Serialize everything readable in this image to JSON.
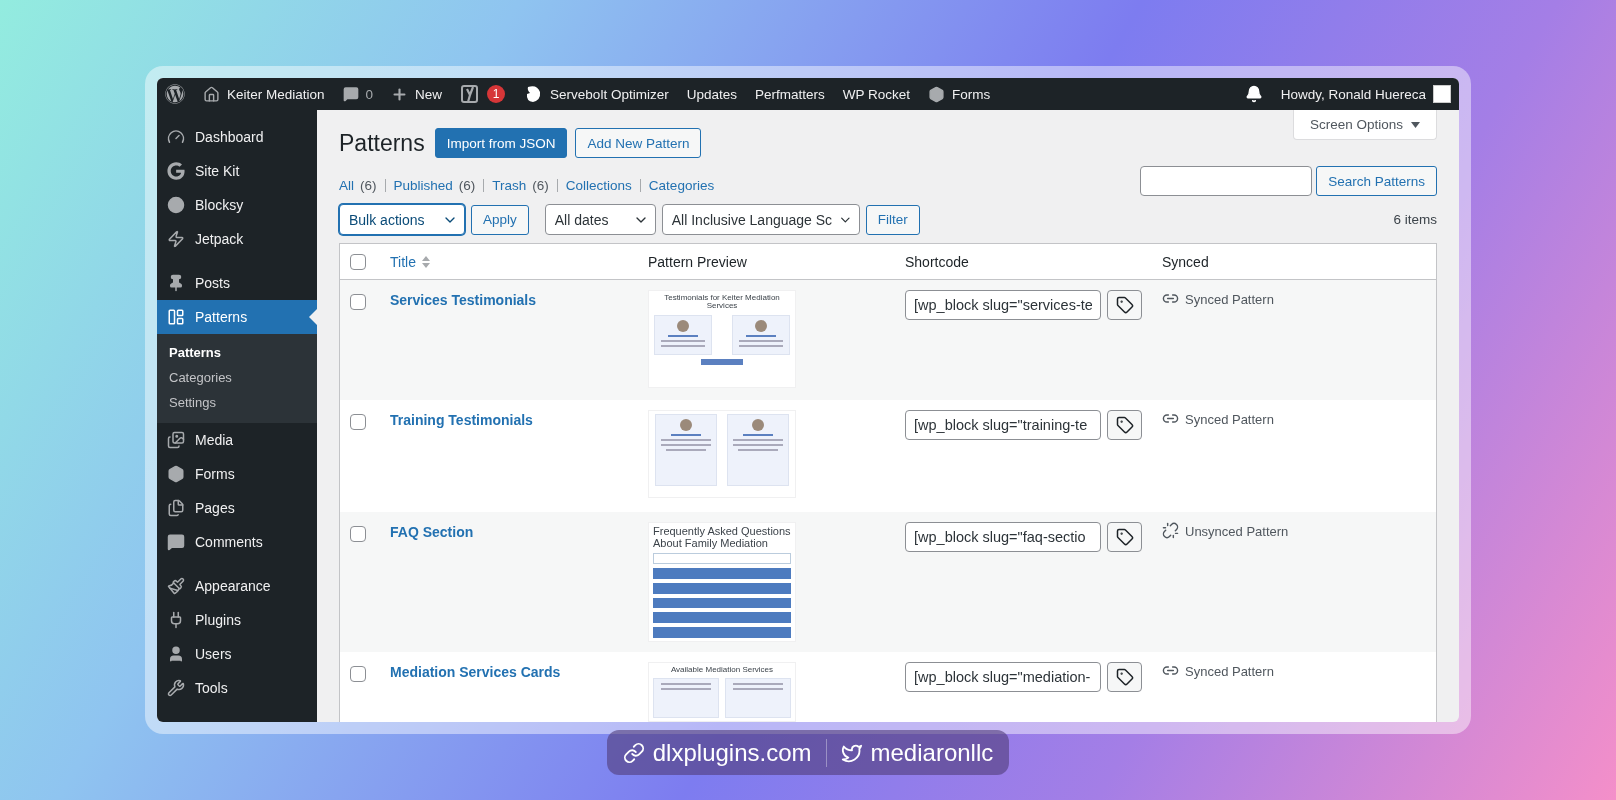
{
  "admin_bar": {
    "items": [
      {
        "kind": "wp-logo"
      },
      {
        "kind": "site",
        "label": "Keiter Mediation"
      },
      {
        "kind": "comments",
        "label": "0"
      },
      {
        "kind": "new",
        "label": "New"
      },
      {
        "kind": "yoast",
        "badge": "1"
      },
      {
        "kind": "servebolt",
        "label": "Servebolt Optimizer"
      },
      {
        "kind": "text",
        "label": "Updates"
      },
      {
        "kind": "text",
        "label": "Perfmatters"
      },
      {
        "kind": "text",
        "label": "WP Rocket"
      },
      {
        "kind": "forms",
        "label": "Forms"
      }
    ],
    "account": {
      "greeting": "Howdy, Ronald Huereca"
    }
  },
  "sidebar": {
    "groups": [
      [
        {
          "kind": "dashboard",
          "label": "Dashboard",
          "selected": false
        },
        {
          "kind": "sitekit",
          "label": "Site Kit",
          "selected": false
        },
        {
          "kind": "blocksy",
          "label": "Blocksy",
          "selected": false
        },
        {
          "kind": "jetpack",
          "label": "Jetpack",
          "selected": false
        }
      ],
      [
        {
          "kind": "posts",
          "label": "Posts",
          "selected": false
        },
        {
          "kind": "patterns",
          "label": "Patterns",
          "selected": true,
          "children": [
            {
              "label": "Patterns",
              "selected": true
            },
            {
              "label": "Categories",
              "selected": false
            },
            {
              "label": "Settings",
              "selected": false
            }
          ]
        },
        {
          "kind": "media",
          "label": "Media",
          "selected": false
        },
        {
          "kind": "forms",
          "label": "Forms",
          "selected": false
        },
        {
          "kind": "pages",
          "label": "Pages",
          "selected": false
        },
        {
          "kind": "comments",
          "label": "Comments",
          "selected": false
        }
      ],
      [
        {
          "kind": "appearance",
          "label": "Appearance",
          "selected": false
        },
        {
          "kind": "plugins",
          "label": "Plugins",
          "selected": false
        },
        {
          "kind": "users",
          "label": "Users",
          "selected": false
        },
        {
          "kind": "tools",
          "label": "Tools",
          "selected": false
        }
      ]
    ]
  },
  "page": {
    "title": "Patterns",
    "actions": [
      {
        "kind": "primary",
        "label": "Import from JSON"
      },
      {
        "kind": "secondary",
        "label": "Add New Pattern"
      }
    ],
    "screen_options": "Screen Options",
    "views": [
      {
        "label": "All",
        "count": "(6)"
      },
      {
        "label": "Published",
        "count": "(6)"
      },
      {
        "label": "Trash",
        "count": "(6)"
      },
      {
        "label": "Collections"
      },
      {
        "label": "Categories"
      }
    ],
    "search": {
      "button": "Search Patterns"
    },
    "filters": {
      "bulk_actions": "Bulk actions",
      "apply": "Apply",
      "dates": "All dates",
      "language": "All Inclusive Language Sc",
      "filter": "Filter",
      "count": "6 items"
    }
  },
  "table": {
    "select_all": {
      "checked": false
    },
    "columns": [
      {
        "label": "Title",
        "sortable": true
      },
      {
        "label": "Pattern Preview",
        "sortable": false
      },
      {
        "label": "Shortcode",
        "sortable": false
      },
      {
        "label": "Synced",
        "sortable": false
      }
    ],
    "rows": [
      {
        "checked": false,
        "title": "Services Testimonials",
        "preview": {
          "kind": "testimonials",
          "heading": "Testimonials for Keiter Mediation Services"
        },
        "shortcode": "[wp_block slug=\"services-te",
        "synced": true,
        "synced_label": "Synced Pattern"
      },
      {
        "checked": false,
        "title": "Training Testimonials",
        "preview": {
          "kind": "cards"
        },
        "shortcode": "[wp_block slug=\"training-te",
        "synced": true,
        "synced_label": "Synced Pattern"
      },
      {
        "checked": false,
        "title": "FAQ Section",
        "preview": {
          "kind": "faq",
          "heading": "Frequently Asked Questions About Family Mediation"
        },
        "shortcode": "[wp_block slug=\"faq-sectio",
        "synced": false,
        "synced_label": "Unsynced Pattern"
      },
      {
        "checked": false,
        "title": "Mediation Services Cards",
        "preview": {
          "kind": "services",
          "heading": "Available Mediation Services"
        },
        "shortcode": "[wp_block slug=\"mediation-",
        "synced": true,
        "synced_label": "Synced Pattern"
      }
    ]
  },
  "footer_badge": {
    "site": "dlxplugins.com",
    "handle": "mediaronllc"
  }
}
